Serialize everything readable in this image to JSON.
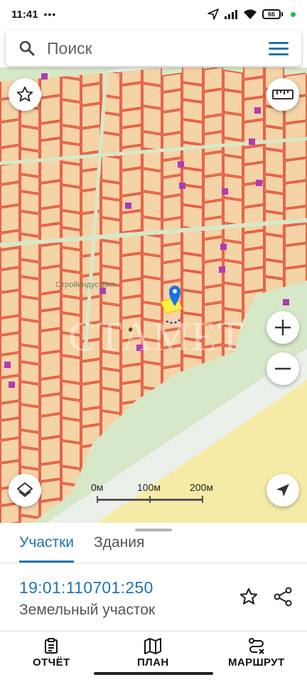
{
  "status_bar": {
    "time": "11:41",
    "notification_dots": "•••",
    "battery": "66"
  },
  "search": {
    "placeholder": "Поиск"
  },
  "map": {
    "place_label": "Стройиндустрия",
    "watermark": "СТАМЕТ",
    "scale_labels": [
      "0м",
      "100м",
      "200м"
    ],
    "colors": {
      "background": "#d7e8c8",
      "parcel_fill": "#f4d3a6",
      "parcel_border": "#e8452c",
      "road": "#ecf0ea",
      "field": "#f6eba6",
      "building": "#b03bb5",
      "selected_parcel": "#f9f04a",
      "pin": "#1a73e8"
    }
  },
  "tabs": [
    {
      "label": "Участки",
      "active": true
    },
    {
      "label": "Здания",
      "active": false
    }
  ],
  "parcel": {
    "cadastral_number": "19:01:110701:250",
    "type": "Земельный участок"
  },
  "bottom_nav": [
    {
      "label": "ОТЧЁТ",
      "icon": "report-icon"
    },
    {
      "label": "ПЛАН",
      "icon": "map-icon"
    },
    {
      "label": "МАРШРУТ",
      "icon": "route-icon"
    }
  ],
  "icons": {
    "search": "search-icon",
    "menu": "menu-icon",
    "favorite": "star-icon",
    "ruler": "ruler-icon",
    "zoom_in": "plus-icon",
    "zoom_out": "minus-icon",
    "layers": "layers-icon",
    "location": "navigation-arrow-icon",
    "share": "share-icon"
  }
}
